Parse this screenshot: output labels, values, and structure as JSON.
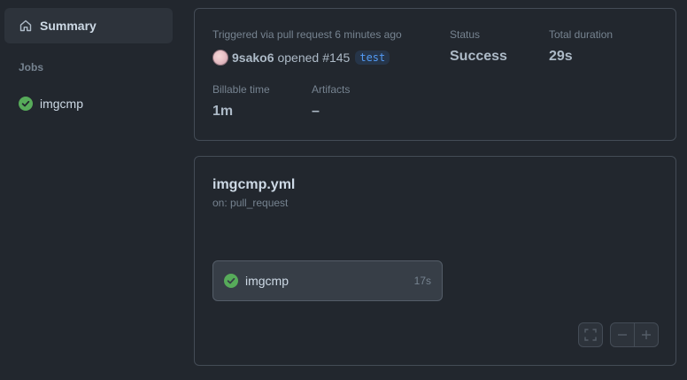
{
  "sidebar": {
    "summary_label": "Summary",
    "jobs_heading": "Jobs",
    "jobs": [
      {
        "name": "imgcmp",
        "status": "success"
      }
    ]
  },
  "run": {
    "trigger_text": "Triggered via pull request 6 minutes ago",
    "actor": "9sako6",
    "action": "opened",
    "pr": "#145",
    "branch": "test",
    "status_label": "Status",
    "status_value": "Success",
    "duration_label": "Total duration",
    "duration_value": "29s",
    "billable_label": "Billable time",
    "billable_value": "1m",
    "artifacts_label": "Artifacts",
    "artifacts_value": "–"
  },
  "workflow": {
    "file": "imgcmp.yml",
    "trigger": "on: pull_request",
    "job": {
      "name": "imgcmp",
      "duration": "17s"
    }
  },
  "colors": {
    "background": "#22272e",
    "success": "#57ab5a",
    "accent": "#539bf5"
  }
}
